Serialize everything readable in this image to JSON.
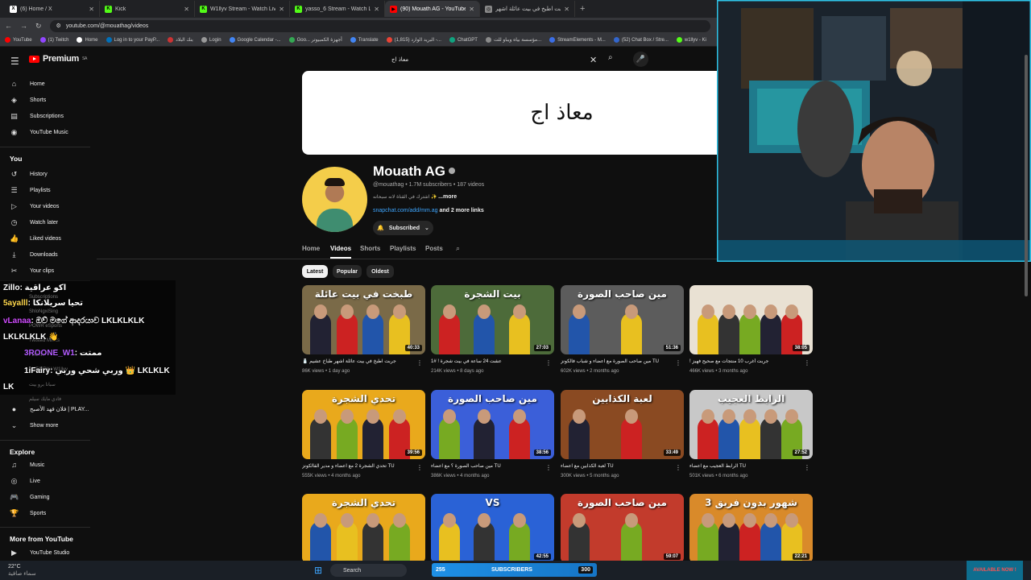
{
  "browser": {
    "tabs": [
      {
        "label": "(6) Home / X",
        "fav": "X",
        "color": "#ffffff"
      },
      {
        "label": "Kick",
        "fav": "K",
        "color": "#53fc18"
      },
      {
        "label": "W1llyv Stream - Watch Live on",
        "fav": "K",
        "color": "#53fc18"
      },
      {
        "label": "yasso_6 Stream - Watch Li",
        "fav": "K",
        "color": "#53fc18"
      },
      {
        "label": "(90) Mouath AG - YouTube",
        "fav": "▶",
        "color": "#ff0000"
      },
      {
        "label": "جربت اطبخ في بيت عائلة اشهر",
        "fav": "◎",
        "color": "#888888"
      }
    ],
    "url": "youtube.com/@mouathag/videos",
    "bookmarks": [
      "YouTube",
      "(1) Twitch",
      "Home",
      "Log in to your PayP...",
      "بنك البلاد",
      "Login",
      "Google Calendar -...",
      "Goo... أجهزة الكمبيوتر",
      "Translate",
      "(1,815) البريد الوارد -...",
      "ChatGPT",
      "مؤسسة بياه ويباو للت...",
      "StreamElements - M...",
      "(52) Chat Box / Stre...",
      "w1llyv - Ki"
    ]
  },
  "youtube": {
    "logo_text": "Premium",
    "logo_sup": "SA",
    "search_value": "معاذ اج",
    "sidebar": {
      "main": [
        {
          "label": "Home",
          "icon": "⌂",
          "name": "home"
        },
        {
          "label": "Shorts",
          "icon": "◈",
          "name": "shorts"
        },
        {
          "label": "Subscriptions",
          "icon": "▤",
          "name": "subscriptions"
        },
        {
          "label": "YouTube Music",
          "icon": "◉",
          "name": "youtube-music"
        }
      ],
      "you_label": "You",
      "you": [
        {
          "label": "History",
          "icon": "↺",
          "name": "history"
        },
        {
          "label": "Playlists",
          "icon": "☰",
          "name": "playlists"
        },
        {
          "label": "Your videos",
          "icon": "▷",
          "name": "your-videos"
        },
        {
          "label": "Watch later",
          "icon": "◷",
          "name": "watch-later"
        },
        {
          "label": "Liked videos",
          "icon": "👍",
          "name": "liked-videos"
        },
        {
          "label": "Downloads",
          "icon": "⤓",
          "name": "downloads"
        },
        {
          "label": "Your clips",
          "icon": "✂",
          "name": "your-clips"
        }
      ],
      "subs_partial": [
        "Subscriptions",
        "ShloNgxiSing",
        "POWR eSports",
        "Twisted Minds",
        "Falcons",
        "1LIFAIRY | W1llyv",
        "سبانا برو بيت",
        "فادي مايك سيلم"
      ],
      "sub_last": "فلان فهد الأصبح | PLAY...",
      "show_more": "Show more",
      "explore_label": "Explore",
      "explore": [
        {
          "label": "Music",
          "icon": "♫",
          "name": "music"
        },
        {
          "label": "Live",
          "icon": "◎",
          "name": "live"
        },
        {
          "label": "Gaming",
          "icon": "🎮",
          "name": "gaming"
        },
        {
          "label": "Sports",
          "icon": "🏆",
          "name": "sports"
        }
      ],
      "more_label": "More from YouTube",
      "more": [
        {
          "label": "YouTube Studio",
          "icon": "▶",
          "name": "youtube-studio"
        }
      ]
    },
    "channel": {
      "banner_text": "معاذ اج",
      "name": "Mouath AG",
      "handle": "@mouathag",
      "subscribers": "1.7M subscribers",
      "videos_count": "187 videos",
      "description": "اشترك في القناة لانه سبحانه ✨",
      "more": "...more",
      "link": "snapchat.com/add/mm.ag",
      "other_links": "and 2 more links",
      "subscribed": "Subscribed"
    },
    "tabs": [
      "Home",
      "Videos",
      "Shorts",
      "Playlists",
      "Posts"
    ],
    "chips": [
      "Latest",
      "Popular",
      "Oldest"
    ],
    "videos": [
      {
        "title": "جربت اطبخ في بيت عائلة اشهر طباخ عشيم 🧂",
        "views": "86K views",
        "age": "1 day ago",
        "duration": "40:33",
        "thumb_text": "طبخت في بيت عائلة",
        "bg": "#7a6a48"
      },
      {
        "title": "عشت 24 ساعة في بيت شجرة ! #1",
        "views": "214K views",
        "age": "8 days ago",
        "duration": "27:03",
        "thumb_text": "بيت الشجرة",
        "bg": "#4d6b3a"
      },
      {
        "title": "TU مين صاحب الصورة مع اعضاء و شباب فالكونز",
        "views": "602K views",
        "age": "2 months ago",
        "duration": "51:36",
        "thumb_text": "مين صاحب الصورة",
        "bg": "#5c5c5c"
      },
      {
        "title": "جربت أغرب 10 منتجات مع صحيح فهيز !",
        "views": "466K views",
        "age": "3 months ago",
        "duration": "38:05",
        "thumb_text": "",
        "bg": "#e9e1d3"
      },
      {
        "title": "TU تحدي الشجرة 2 مع اعضاء و مدير الفالكونز",
        "views": "555K views",
        "age": "4 months ago",
        "duration": "39:56",
        "thumb_text": "تحدي الشجرة",
        "bg": "#e9a91c"
      },
      {
        "title": "TU مين صاحب الصورة ؟ مع اعضاء",
        "views": "386K views",
        "age": "4 months ago",
        "duration": "38:56",
        "thumb_text": "مين صاحب الصورة",
        "bg": "#3b5fd9"
      },
      {
        "title": "TU لعبة الكذابين مع اعضاء",
        "views": "300K views",
        "age": "5 months ago",
        "duration": "33:49",
        "thumb_text": "لعبة الكذابين",
        "bg": "#8a4a22"
      },
      {
        "title": "TU الرابط العجيب مع اعضاء",
        "views": "501K views",
        "age": "6 months ago",
        "duration": "27:52",
        "thumb_text": "الرابط العجيب",
        "bg": "#c8c8c8"
      },
      {
        "title": "",
        "views": "",
        "age": "",
        "duration": "",
        "thumb_text": "تحدي الشجرة",
        "bg": "#e9a91c"
      },
      {
        "title": "",
        "views": "",
        "age": "",
        "duration": "42:55",
        "thumb_text": "VS",
        "bg": "#2a62d6"
      },
      {
        "title": "",
        "views": "",
        "age": "",
        "duration": "59:07",
        "thumb_text": "مين صاحب الصورة",
        "bg": "#c23b2c"
      },
      {
        "title": "",
        "views": "",
        "age": "",
        "duration": "22:21",
        "thumb_text": "3 شهور بدون فريق",
        "bg": "#d98a2a"
      }
    ]
  },
  "chat": [
    {
      "user": "Zillo",
      "msg": ": اكو عراقية",
      "color": "#ffffff"
    },
    {
      "user": "5ayalll",
      "msg": ": تحيا سريلانكا",
      "color": "#ffd84d"
    },
    {
      "user": "vLanaa",
      "msg": ": ඔව් මගේ ආදරයාව LKLKLKLK",
      "color": "#d04cff"
    },
    {
      "user": "",
      "msg": "LKLKLKLK 👋",
      "color": "#ffffff"
    },
    {
      "user": "3ROONE_W1",
      "msg": ": ممتت",
      "color": "#b35cff"
    },
    {
      "user": "1iFairy",
      "msg": ": وربي شحي وربي 👑 LKLKLK",
      "color": "#ffffff"
    },
    {
      "user": "LK",
      "msg": "",
      "color": "#ffffff"
    }
  ],
  "taskbar": {
    "weather_temp": "22°C",
    "weather_desc": "سماء صافية",
    "search": "Search",
    "subs_left": "255",
    "subs_label": "SUBSCRIBERS",
    "subs_right": "300",
    "promo": "AVAILABLE NOW !"
  }
}
